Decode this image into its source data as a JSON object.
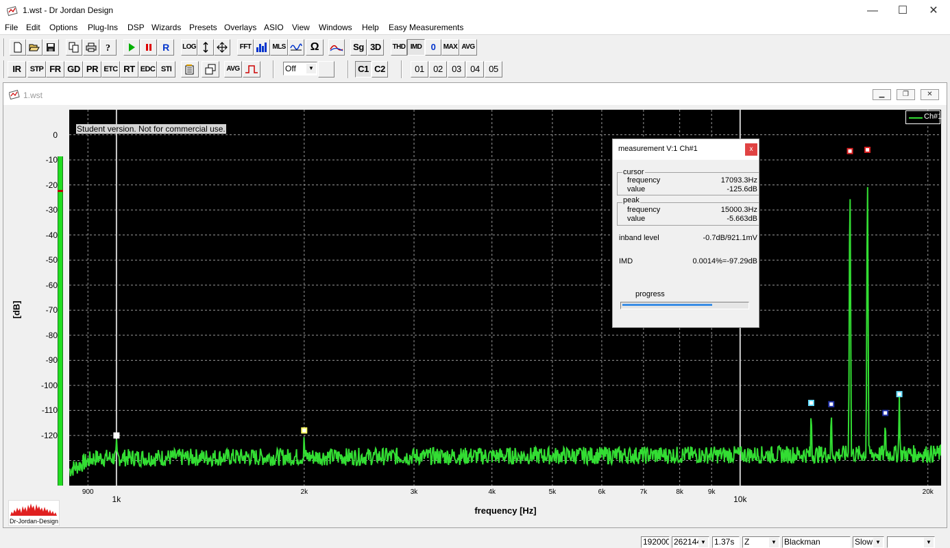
{
  "window": {
    "title": "1.wst - Dr Jordan Design",
    "minimize": "—",
    "maximize": "☐",
    "close": "✕"
  },
  "menu": [
    "File",
    "Edit",
    "Options",
    "Plug-Ins",
    "DSP",
    "Wizards",
    "Presets",
    "Overlays",
    "ASIO",
    "View",
    "Windows",
    "Help",
    "Easy Measurements"
  ],
  "toolbar1": {
    "log": "LOG",
    "fft": "FFT",
    "mls": "MLS",
    "sg": "Sg",
    "three_d": "3D",
    "thd": "THD",
    "imd": "IMD",
    "zero": "0",
    "max": "MAX",
    "avg": "AVG",
    "record": "R"
  },
  "toolbar2": {
    "ir": "IR",
    "stp": "STP",
    "fr": "FR",
    "gd": "GD",
    "pr": "PR",
    "etc": "ETC",
    "rt": "RT",
    "edc": "EDC",
    "sti": "STI",
    "avg": "AVG",
    "select_value": "Off",
    "c1": "C1",
    "c2": "C2",
    "overlays": [
      "01",
      "02",
      "03",
      "04",
      "05"
    ]
  },
  "mdi": {
    "title": "1.wst"
  },
  "plot": {
    "watermark": "Student version. Not for commercial use.",
    "legend": "Ch#1",
    "ylabel": "[dB]",
    "xlabel": "frequency [Hz]",
    "yticks": [
      "0",
      "-10",
      "-20",
      "-30",
      "-40",
      "-50",
      "-60",
      "-70",
      "-80",
      "-90",
      "-100",
      "-110",
      "-120"
    ],
    "xticks_minor": [
      "900",
      "2k",
      "3k",
      "4k",
      "5k",
      "6k",
      "7k",
      "8k",
      "9k",
      "20k"
    ],
    "xticks_major": [
      "1k",
      "10k"
    ],
    "logo_text": "Dr-Jordan-Design"
  },
  "chart_data": {
    "type": "line",
    "xlabel": "frequency [Hz]",
    "ylabel": "[dB]",
    "xscale": "log",
    "xlim": [
      840,
      21000
    ],
    "ylim": [
      -140,
      10
    ],
    "grid": true,
    "legend_position": "top-right",
    "colors": {
      "series": "#33dd33",
      "background": "#000000",
      "grid": "#9a9a9a"
    },
    "series": [
      {
        "name": "Ch#1",
        "points": [
          [
            1000,
            -120
          ],
          [
            2000,
            -117.5
          ],
          [
            13000,
            -107
          ],
          [
            14000,
            -107.5
          ],
          [
            15000,
            -5.663
          ],
          [
            16000,
            -5.2
          ],
          [
            17093.3,
            -111
          ],
          [
            18000,
            -103.5
          ]
        ]
      }
    ],
    "markers": [
      {
        "x": 1000,
        "y": -120,
        "color": "#ffffff"
      },
      {
        "x": 2000,
        "y": -118,
        "color": "#ffff66"
      },
      {
        "x": 13000,
        "y": -107,
        "color": "#66ddff"
      },
      {
        "x": 14000,
        "y": -107.5,
        "color": "#2233aa"
      },
      {
        "x": 15000,
        "y": -6.5,
        "color": "#dd2222"
      },
      {
        "x": 16000,
        "y": -6,
        "color": "#dd2222"
      },
      {
        "x": 17093.3,
        "y": -111,
        "color": "#2233aa"
      },
      {
        "x": 18000,
        "y": -103.5,
        "color": "#66ddff"
      }
    ],
    "cursor_x": [
      1000,
      10000
    ],
    "level_meter": {
      "value_db": -120,
      "peak_db": -22
    }
  },
  "measurement": {
    "title": "measurement V:1 Ch#1",
    "close": "x",
    "cursor": {
      "label": "cursor",
      "frequency_label": "frequency",
      "frequency": "17093.3Hz",
      "value_label": "value",
      "value": "-125.6dB"
    },
    "peak": {
      "label": "peak",
      "frequency_label": "frequency",
      "frequency": "15000.3Hz",
      "value_label": "value",
      "value": "-5.663dB"
    },
    "inband_label": "inband level",
    "inband": "-0.7dB/921.1mV",
    "imd_label": "IMD",
    "imd": "0.0014%=-97.29dB",
    "progress_label": "progress",
    "progress": 0.72
  },
  "status": {
    "rate": "192000",
    "fft_size": "262144",
    "time": "1.37s",
    "weighting": "Z",
    "window": "Blackman",
    "speed": "Slow",
    "extra": ""
  }
}
